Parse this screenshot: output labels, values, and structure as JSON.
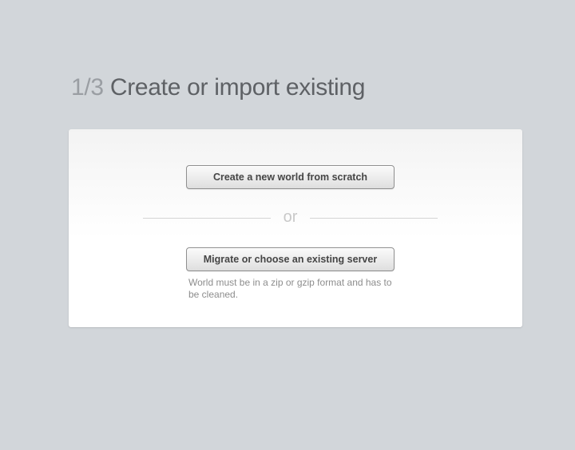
{
  "header": {
    "step": "1/3",
    "title": "Create or import existing"
  },
  "card": {
    "create_button_label": "Create a new world from scratch",
    "divider_text": "or",
    "migrate_button_label": "Migrate or choose an existing server",
    "migrate_hint": "World must be in a zip or gzip format and has to be cleaned."
  },
  "colors": {
    "background": "#d2d6da",
    "title_text": "#5e6165",
    "step_text": "#9a9ea3",
    "card_background": "#ffffff",
    "button_border": "#8f8f8f",
    "hint_text": "#8d8d8d"
  }
}
